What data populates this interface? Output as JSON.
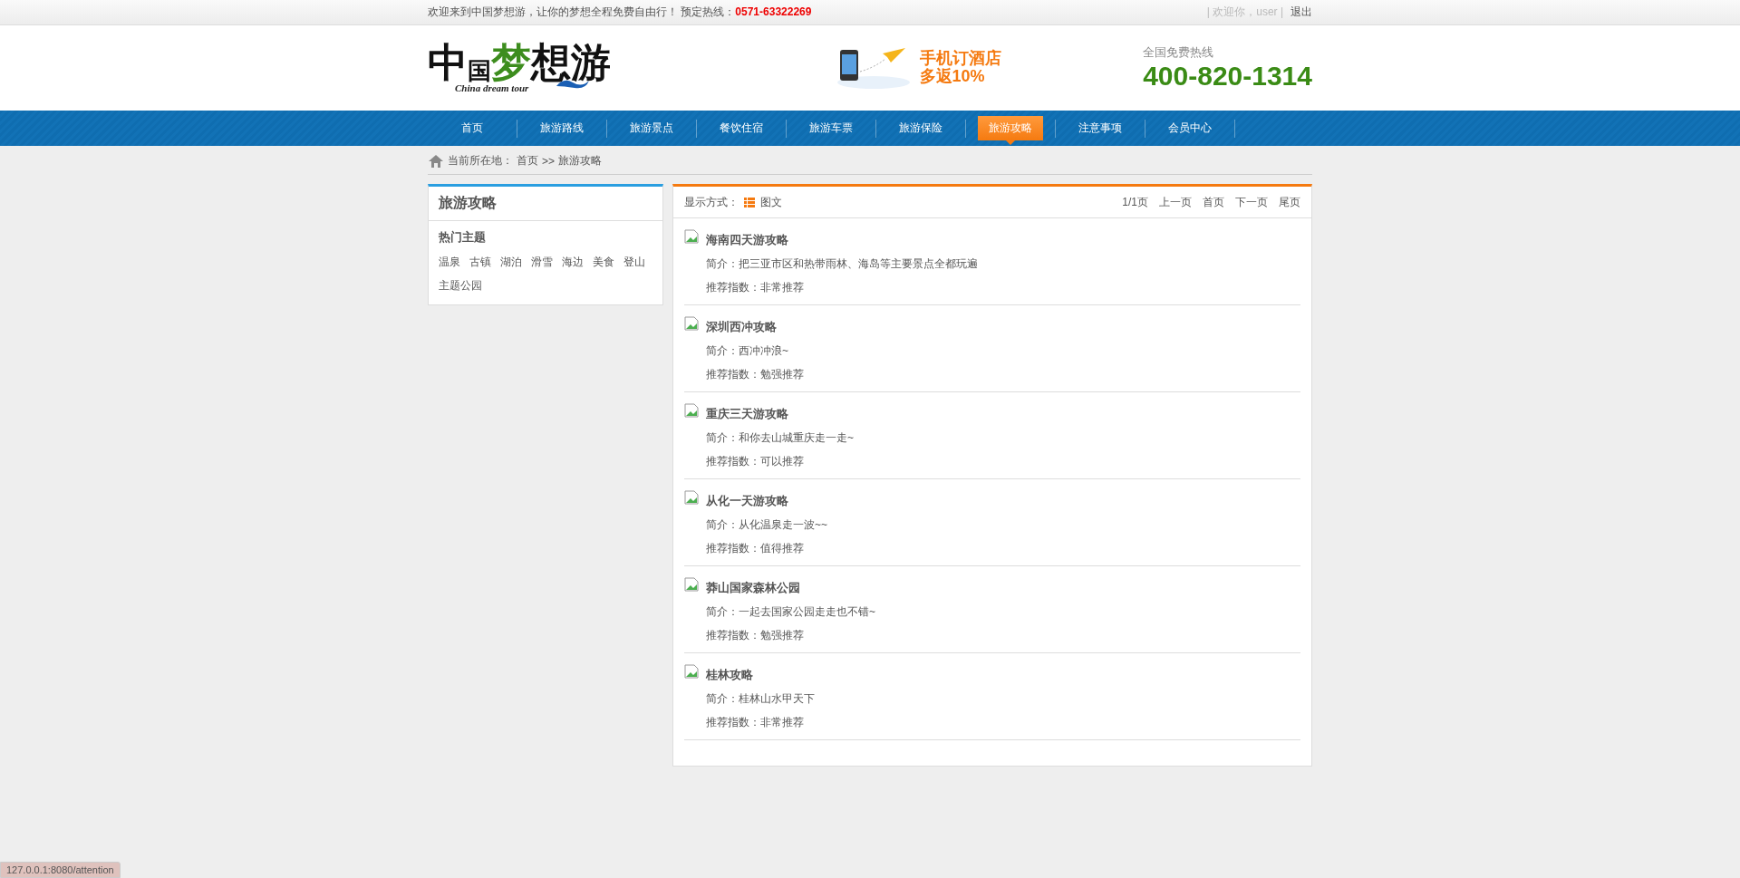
{
  "top_bar": {
    "welcome": "欢迎来到中国梦想游，让你的梦想全程免费自由行！ 预定热线：",
    "hotline": "0571-63322269",
    "user_greeting": "| 欢迎你，user |",
    "logout": "退出"
  },
  "header": {
    "logo": {
      "title_parts": [
        "中",
        "国",
        "梦",
        "想",
        "游"
      ],
      "subtitle": "China dream tour"
    },
    "promo": {
      "line_1": "手机订酒店",
      "line_2": "多返10%"
    },
    "hotline_label": "全国免费热线",
    "hotline_number": "400-820-1314"
  },
  "nav": [
    {
      "label": "首页",
      "selected": false
    },
    {
      "label": "旅游路线",
      "selected": false
    },
    {
      "label": "旅游景点",
      "selected": false
    },
    {
      "label": "餐饮住宿",
      "selected": false
    },
    {
      "label": "旅游车票",
      "selected": false
    },
    {
      "label": "旅游保险",
      "selected": false
    },
    {
      "label": "旅游攻略",
      "selected": true
    },
    {
      "label": "注意事项",
      "selected": false
    },
    {
      "label": "会员中心",
      "selected": false
    }
  ],
  "breadcrumb": {
    "prefix": "当前所在地：",
    "items": [
      "首页",
      ">>",
      "旅游攻略"
    ]
  },
  "sidebar": {
    "title": "旅游攻略",
    "section_title": "热门主题",
    "tags": [
      "温泉",
      "古镇",
      "湖泊",
      "滑雪",
      "海边",
      "美食",
      "登山",
      "主题公园"
    ]
  },
  "list_toolbar": {
    "display_label": "显示方式：",
    "display_mode": "图文",
    "page_info": "1/1页",
    "pager": [
      "上一页",
      "首页",
      "下一页",
      "尾页"
    ]
  },
  "articles": [
    {
      "title": "海南四天游攻略",
      "summary": "简介：把三亚市区和热带雨林、海岛等主要景点全都玩遍",
      "rating": "推荐指数：非常推荐"
    },
    {
      "title": "深圳西冲攻略",
      "summary": "简介：西冲冲浪~",
      "rating": "推荐指数：勉强推荐"
    },
    {
      "title": "重庆三天游攻略",
      "summary": "简介：和你去山城重庆走一走~",
      "rating": "推荐指数：可以推荐"
    },
    {
      "title": "从化一天游攻略",
      "summary": "简介：从化温泉走一波~~",
      "rating": "推荐指数：值得推荐"
    },
    {
      "title": "莽山国家森林公园",
      "summary": "简介：一起去国家公园走走也不错~",
      "rating": "推荐指数：勉强推荐"
    },
    {
      "title": "桂林攻略",
      "summary": "简介：桂林山水甲天下",
      "rating": "推荐指数：非常推荐"
    }
  ],
  "status_url": "127.0.0.1:8080/attention"
}
